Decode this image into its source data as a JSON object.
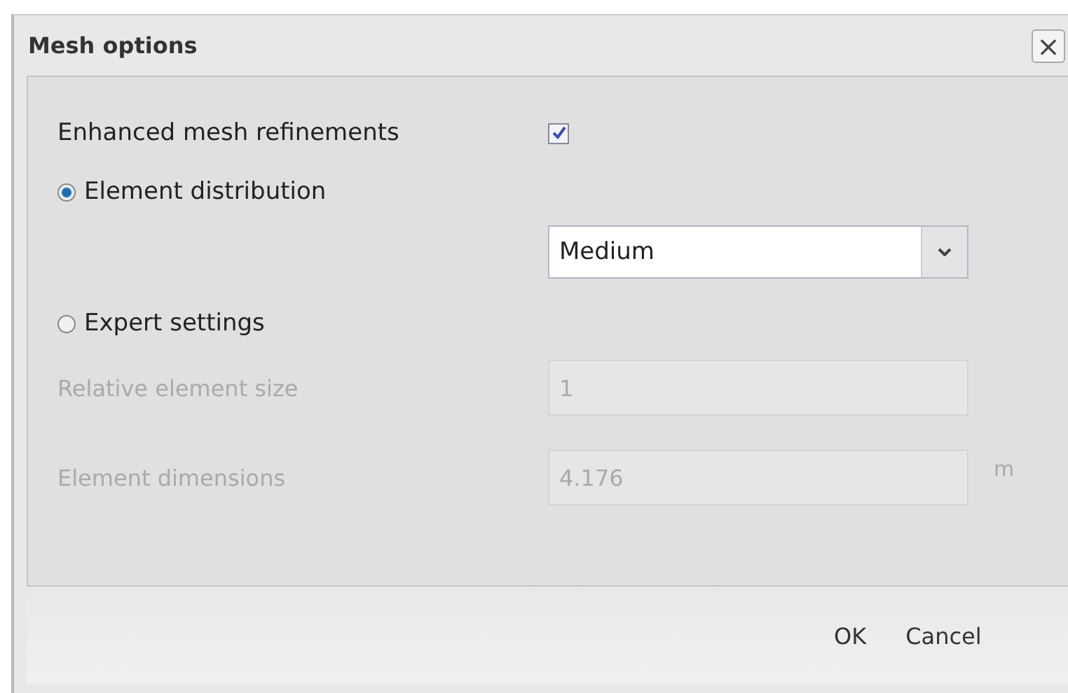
{
  "window": {
    "title": "Mesh options",
    "close_label": "×"
  },
  "enhanced": {
    "label": "Enhanced mesh refinements",
    "checked": true
  },
  "modes": [
    {
      "label": "Element distribution",
      "selected": true
    },
    {
      "label": "Expert settings",
      "selected": false
    }
  ],
  "distribution": {
    "value": "Medium"
  },
  "fields": [
    {
      "label": "Relative element size",
      "value": "1",
      "disabled": true
    },
    {
      "label": "Element dimensions",
      "value": "4.176",
      "unit": "m",
      "disabled": true
    }
  ],
  "buttons": [
    "OK",
    "Cancel"
  ]
}
